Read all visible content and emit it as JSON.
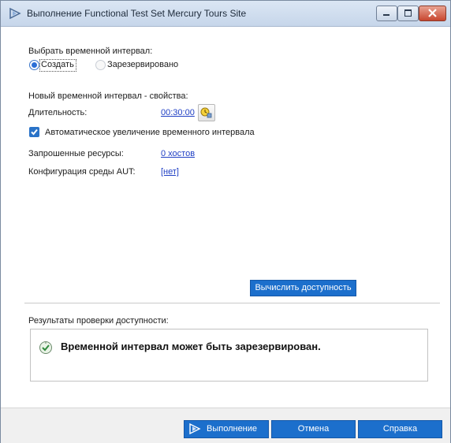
{
  "window": {
    "title": "Выполнение Functional Test Set Mercury Tours Site"
  },
  "timeslot": {
    "label": "Выбрать временной интервал:",
    "options": [
      {
        "label": "Создать",
        "selected": true
      },
      {
        "label": "Зарезервировано",
        "selected": false
      }
    ]
  },
  "properties": {
    "heading": "Новый временной интервал - свойства:",
    "duration_label": "Длительность:",
    "duration_value": "00:30:00",
    "auto_extend_label": "Автоматическое увеличение временного интервала",
    "auto_extend_checked": true,
    "resources_label": "Запрошенные ресурсы:",
    "resources_value": "0 хостов",
    "aut_label": "Конфигурация среды AUT:",
    "aut_value": "[нет]"
  },
  "calc_button": "Вычислить доступность",
  "results": {
    "heading": "Результаты проверки доступности:",
    "message": "Временной интервал может быть зарезервирован."
  },
  "footer": {
    "run": "Выполнение",
    "cancel": "Отмена",
    "help": "Справка"
  },
  "colors": {
    "accent": "#1c6fcc",
    "link": "#1f3fc4",
    "success": "#2f8a3c"
  },
  "icons": {
    "title": "run-arrow-icon",
    "duration": "clock-lightbulb-icon",
    "result": "available-check-icon",
    "run_button": "run-arrow-icon"
  }
}
